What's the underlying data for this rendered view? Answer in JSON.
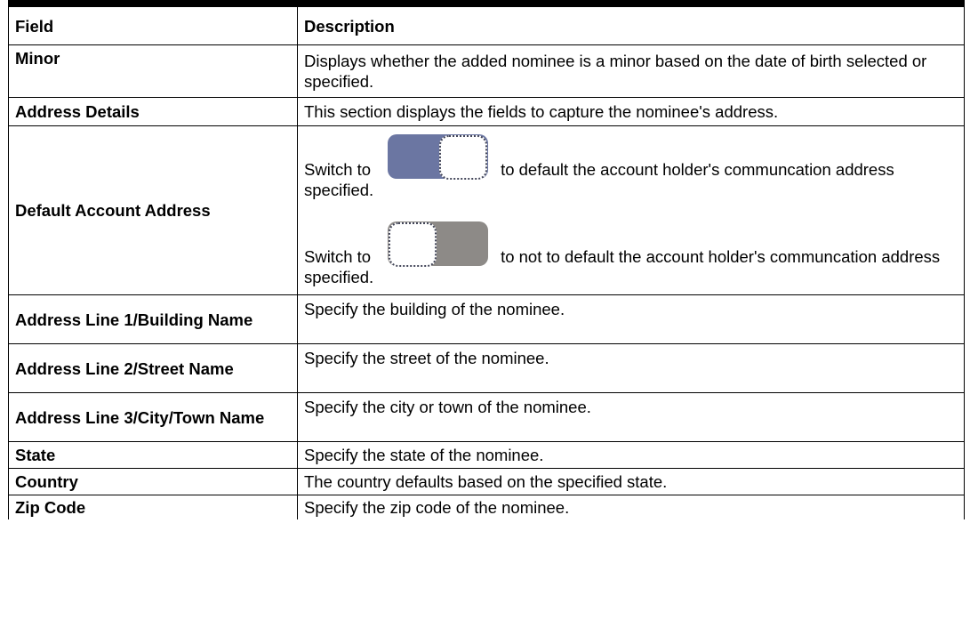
{
  "table": {
    "headers": [
      "Field",
      "Description"
    ],
    "rows": {
      "minor": {
        "field": "Minor",
        "description": "Displays whether the added nominee is a minor based on the date of birth selected or specified."
      },
      "address_details": {
        "field": "Address Details",
        "description": "This section displays the fields to capture the nominee's address."
      },
      "default_account_address": {
        "field": "Default Account Address",
        "switch_on": {
          "prefix": "Switch to",
          "suffix": "to default the account holder's communcation address specified."
        },
        "switch_off": {
          "prefix": "Switch to",
          "suffix": "to not to default the account holder's communcation address specified."
        }
      },
      "address_line_1": {
        "field": "Address Line 1/Building Name",
        "description": "Specify the building of the nominee."
      },
      "address_line_2": {
        "field": "Address Line 2/Street Name",
        "description": "Specify the street of the nominee."
      },
      "address_line_3": {
        "field": "Address Line 3/City/Town Name",
        "description": "Specify the city or town of the nominee."
      },
      "state": {
        "field": "State",
        "description": "Specify the state of the nominee."
      },
      "country": {
        "field": "Country",
        "description": "The country defaults based on the specified state."
      },
      "zip_code": {
        "field": "Zip Code",
        "description": "Specify the zip code of the nominee."
      }
    }
  },
  "toggle_icons": {
    "on": {
      "icon": "toggle-on-icon",
      "track_color": "#6b76a2"
    },
    "off": {
      "icon": "toggle-off-icon",
      "track_color": "#8d8a87"
    }
  }
}
